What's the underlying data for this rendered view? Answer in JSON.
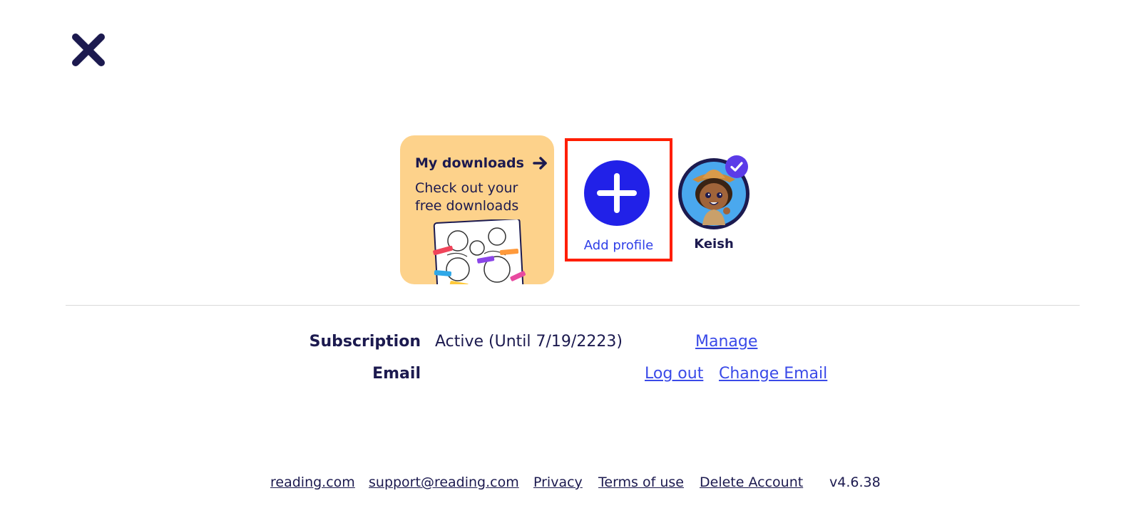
{
  "header": {
    "close_icon": "close-icon"
  },
  "downloads_card": {
    "title": "My downloads",
    "subtitle": "Check out your free downloads",
    "arrow_icon": "arrow-right-icon",
    "background_color": "#fdd28b"
  },
  "profiles": {
    "add_profile": {
      "label": "Add profile",
      "icon": "plus-icon",
      "circle_color": "#2121e8",
      "highlight_color": "#ff1e00"
    },
    "items": [
      {
        "name": "Keish",
        "selected": true,
        "badge_icon": "check-icon",
        "badge_color": "#5b3be8"
      }
    ]
  },
  "account": {
    "subscription_label": "Subscription",
    "subscription_value": "Active (Until 7/19/2223)",
    "manage_link": "Manage",
    "email_label": "Email",
    "logout_link": "Log out",
    "change_email_link": "Change Email"
  },
  "footer": {
    "links": [
      "reading.com",
      "support@reading.com",
      "Privacy",
      "Terms of use",
      "Delete Account"
    ],
    "version": "v4.6.38"
  },
  "colors": {
    "text_dark": "#1c1a4f",
    "link_blue": "#3a4ae8"
  }
}
